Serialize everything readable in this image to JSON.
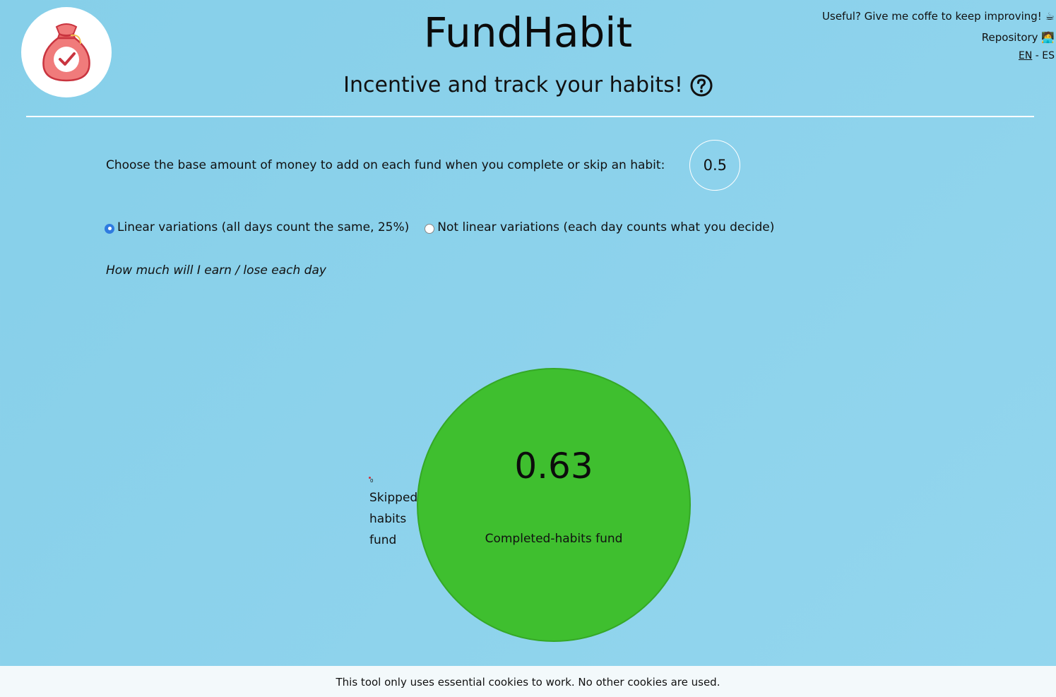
{
  "header": {
    "title": "FundHabit",
    "subtitle": "Incentive and track your habits!",
    "links": {
      "coffee": "Useful? Give me coffe to keep improving! ☕",
      "repository": "Repository 🧑‍💻",
      "lang_en": "EN",
      "lang_sep": " - ",
      "lang_es": "ES"
    }
  },
  "settings": {
    "base_amount_label": "Choose the base amount of money to add on each fund when you complete or skip an habit:",
    "base_amount_value": "0.5",
    "radio_linear_label": "Linear variations (all days count the same, 25%)",
    "radio_nonlinear_label": "Not linear variations (each day counts what you decide)",
    "selected_variation": "linear",
    "hint_label": "How much will I earn / lose each day"
  },
  "funds": {
    "completed": {
      "value": "0.63",
      "label": "Completed-habits fund",
      "color": "#3fbf2f"
    },
    "skipped": {
      "value": "0",
      "label": "Skipped-habits fund",
      "color": "#d0303a"
    }
  },
  "cookie_notice": "This tool only uses essential cookies to work. No other cookies are used.",
  "icons": {
    "logo": "money-bag-check-icon",
    "help": "question-circle-icon"
  }
}
